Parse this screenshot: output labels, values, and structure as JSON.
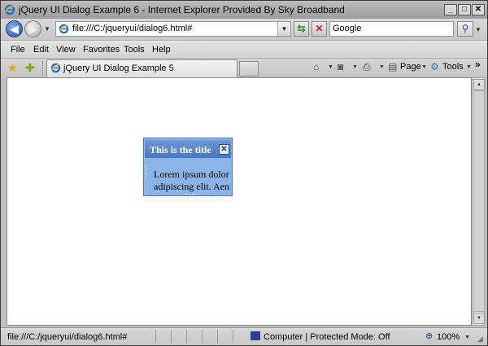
{
  "window": {
    "title": "jQuery UI Dialog Example 6 - Internet Explorer Provided By Sky Broadband",
    "minimize": "_",
    "maximize": "□",
    "close": "✕"
  },
  "address_bar": {
    "url": "file:///C:/jqueryui/dialog6.html#",
    "search_placeholder": "Google"
  },
  "menu": {
    "items": [
      "File",
      "Edit",
      "View",
      "Favorites",
      "Tools",
      "Help"
    ]
  },
  "tabs": {
    "active_tab": "jQuery UI Dialog Example 5"
  },
  "command_bar": {
    "page_label": "Page",
    "tools_label": "Tools",
    "more": "»"
  },
  "dialog": {
    "title": "This is the title",
    "close": "✕",
    "body_line1": "Lorem ipsum dolor",
    "body_line2": "adipiscing elit. Aen"
  },
  "status_bar": {
    "status_text": "file:///C:/jqueryui/dialog6.html#",
    "zone": "Computer | Protected Mode: Off",
    "zoom": "100%"
  },
  "icons": {
    "back": "back-arrow-icon",
    "forward": "forward-arrow-icon",
    "refresh": "refresh-icon",
    "stop": "stop-icon",
    "search": "search-icon",
    "favorites": "star-icon",
    "add_favorites": "add-favorites-icon",
    "home": "home-icon",
    "feeds": "feed-icon",
    "print": "print-icon",
    "page": "page-icon",
    "tools": "gear-icon"
  },
  "colors": {
    "dialog_title_bg": "#4a76c0",
    "dialog_bg": "#8ab4e8"
  }
}
